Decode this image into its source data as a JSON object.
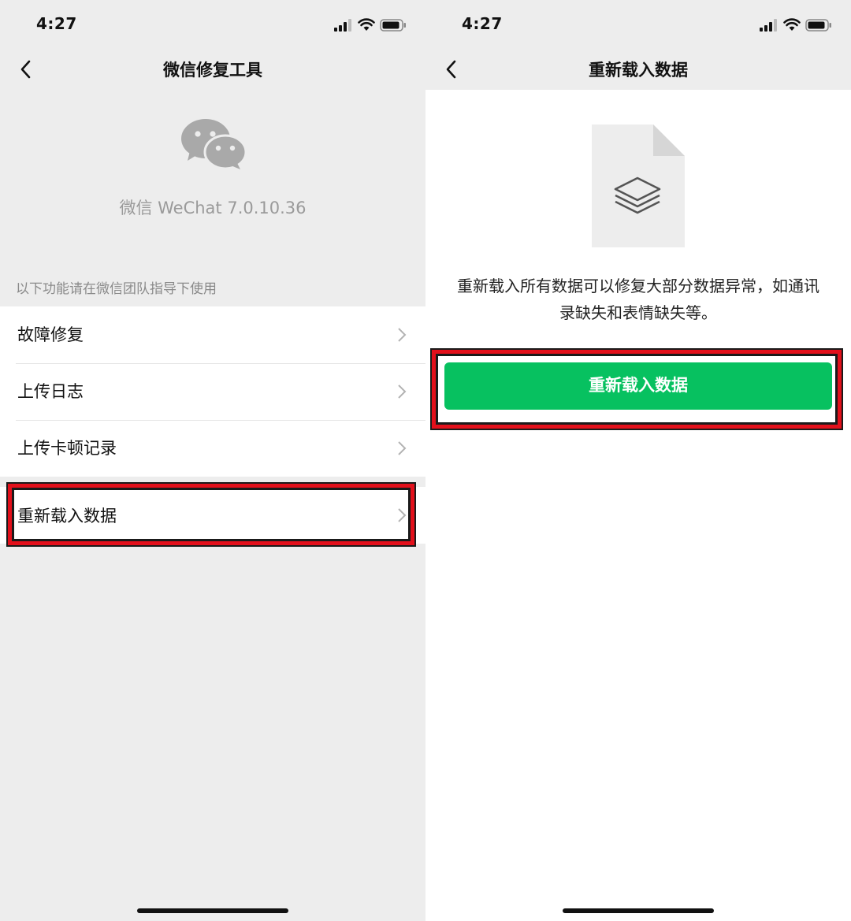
{
  "status_bar": {
    "time": "4:27"
  },
  "left_screen": {
    "nav": {
      "title": "微信修复工具"
    },
    "app_info": {
      "version": "微信 WeChat 7.0.10.36"
    },
    "section_hint": "以下功能请在微信团队指导下使用",
    "menu_items": [
      {
        "label": "故障修复"
      },
      {
        "label": "上传日志"
      },
      {
        "label": "上传卡顿记录"
      }
    ],
    "reload_item": {
      "label": "重新载入数据"
    }
  },
  "right_screen": {
    "nav": {
      "title": "重新载入数据"
    },
    "description": "重新载入所有数据可以修复大部分数据异常，如通讯录缺失和表情缺失等。",
    "button_label": "重新载入数据"
  },
  "colors": {
    "accent_green": "#07c160",
    "highlight_red": "#e3101b",
    "background": "#ededed"
  },
  "icons": [
    "back-arrow-icon",
    "wechat-logo-icon",
    "chevron-right-icon",
    "file-layers-icon",
    "signal-icon",
    "wifi-icon",
    "battery-icon"
  ]
}
